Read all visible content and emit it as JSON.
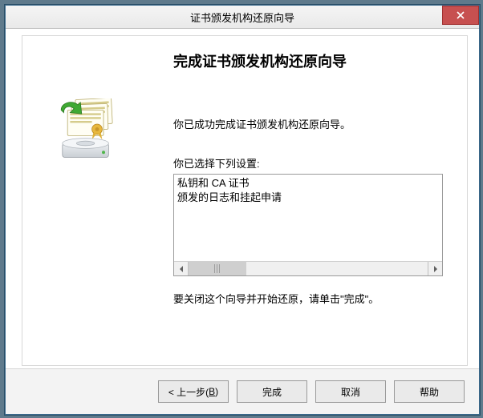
{
  "titlebar": {
    "title": "证书颁发机构还原向导"
  },
  "wizard": {
    "heading": "完成证书颁发机构还原向导",
    "success_text": "你已成功完成证书颁发机构还原向导。",
    "settings_label": "你已选择下列设置:",
    "settings_items": [
      "私钥和 CA 证书",
      "颁发的日志和挂起申请"
    ],
    "instruction": "要关闭这个向导并开始还原，请单击\"完成\"。"
  },
  "buttons": {
    "back_prefix": "< 上一步(",
    "back_hotkey": "B",
    "back_suffix": ")",
    "finish": "完成",
    "cancel": "取消",
    "help": "帮助"
  }
}
